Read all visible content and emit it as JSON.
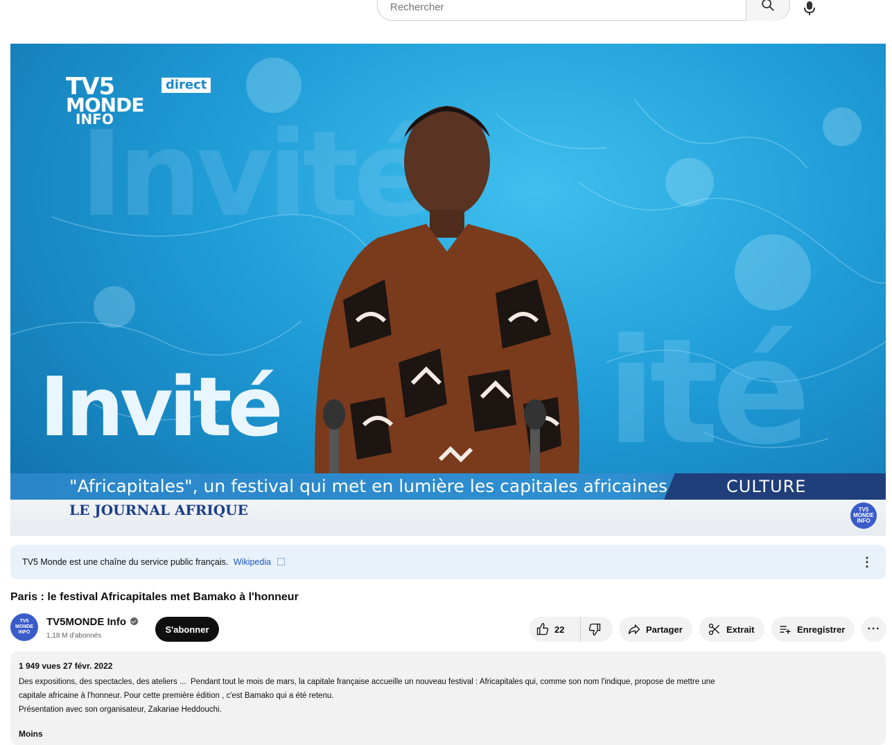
{
  "search": {
    "placeholder": "Rechercher"
  },
  "player": {
    "logo_line1": "TV5",
    "logo_line2": "MONDE",
    "logo_line3": "INFO",
    "live_badge": "direct",
    "show_word": "Invité",
    "headline": "\"Africapitales\", un festival qui met en lumière les capitales africaines",
    "category": "CULTURE",
    "program": "LE JOURNAL AFRIQUE",
    "watermark": "TV5 MONDE INFO"
  },
  "info_panel": {
    "text": "TV5 Monde est une chaîne du service public français.",
    "link": "Wikipedia"
  },
  "video": {
    "title": "Paris : le festival Africapitales met Bamako à l'honneur"
  },
  "channel": {
    "name": "TV5MONDE Info",
    "subscribers": "1,18 M d'abonnés",
    "avatar_text": "TV5 MONDE INFO",
    "subscribe_label": "S'abonner"
  },
  "actions": {
    "likes": "22",
    "share": "Partager",
    "clip": "Extrait",
    "save": "Enregistrer",
    "more": "···"
  },
  "description": {
    "meta": "1 949 vues  27 févr. 2022",
    "line1": "Des expositions, des spectacles, des ateliers ...  Pendant tout le mois de mars, la capitale française accueille un nouveau festival : Africapitales qui, comme son nom l'indique, propose de mettre une",
    "line2": "capitale africaine à l'honneur. Pour cette première édition , c'est Bamako qui a été retenu.",
    "line3": "Présentation avec son organisateur, Zakariae Heddouchi.",
    "less_label": "Moins"
  }
}
